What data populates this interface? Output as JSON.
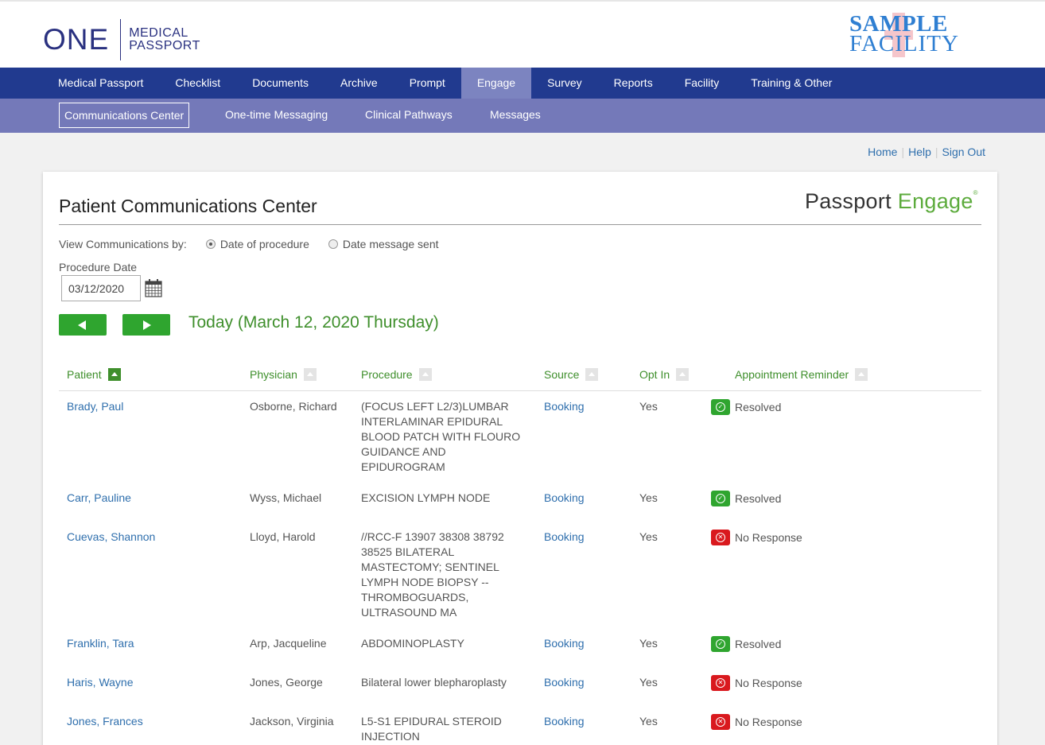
{
  "logo": {
    "one": "ONE",
    "line1": "MEDICAL",
    "line2": "PASSPORT"
  },
  "facility": {
    "line1": "SAMPLE",
    "line2": "FACILITY"
  },
  "main_nav": [
    {
      "label": "Medical Passport"
    },
    {
      "label": "Checklist"
    },
    {
      "label": "Documents"
    },
    {
      "label": "Archive"
    },
    {
      "label": "Prompt"
    },
    {
      "label": "Engage",
      "active": true
    },
    {
      "label": "Survey"
    },
    {
      "label": "Reports"
    },
    {
      "label": "Facility"
    },
    {
      "label": "Training & Other"
    }
  ],
  "sub_nav": [
    {
      "label": "Communications Center",
      "active": true
    },
    {
      "label": "One-time Messaging"
    },
    {
      "label": "Clinical Pathways"
    },
    {
      "label": "Messages"
    }
  ],
  "top_links": {
    "home": "Home",
    "help": "Help",
    "sign_out": "Sign Out"
  },
  "panel": {
    "title": "Patient Communications Center",
    "brand_a": "Passport",
    "brand_b": "Engage",
    "view_by_label": "View Communications by:",
    "options": [
      {
        "label": "Date of procedure",
        "selected": true
      },
      {
        "label": "Date message sent",
        "selected": false
      }
    ],
    "procedure_date_label": "Procedure Date",
    "procedure_date_value": "03/12/2020",
    "today": "Today (March 12, 2020 Thursday)"
  },
  "table": {
    "headers": {
      "patient": "Patient",
      "physician": "Physician",
      "procedure": "Procedure",
      "source": "Source",
      "opt_in": "Opt In",
      "reminder": "Appointment Reminder"
    },
    "rows": [
      {
        "patient": "Brady, Paul",
        "physician": "Osborne, Richard",
        "procedure": "(FOCUS LEFT L2/3)LUMBAR INTERLAMINAR EPIDURAL BLOOD PATCH WITH FLOURO GUIDANCE AND EPIDUROGRAM",
        "source": "Booking",
        "opt_in": "Yes",
        "reminder": "Resolved",
        "status": "ok"
      },
      {
        "patient": "Carr, Pauline",
        "physician": "Wyss, Michael",
        "procedure": "EXCISION LYMPH NODE",
        "source": "Booking",
        "opt_in": "Yes",
        "reminder": "Resolved",
        "status": "ok"
      },
      {
        "patient": "Cuevas, Shannon",
        "physician": "Lloyd, Harold",
        "procedure": "//RCC-F 13907 38308 38792 38525 BILATERAL MASTECTOMY; SENTINEL LYMPH NODE BIOPSY -- THROMBOGUARDS, ULTRASOUND MA",
        "source": "Booking",
        "opt_in": "Yes",
        "reminder": "No Response",
        "status": "no"
      },
      {
        "patient": "Franklin, Tara",
        "physician": "Arp, Jacqueline",
        "procedure": "ABDOMINOPLASTY",
        "source": "Booking",
        "opt_in": "Yes",
        "reminder": "Resolved",
        "status": "ok"
      },
      {
        "patient": "Haris, Wayne",
        "physician": "Jones, George",
        "procedure": "Bilateral lower blepharoplasty",
        "source": "Booking",
        "opt_in": "Yes",
        "reminder": "No Response",
        "status": "no"
      },
      {
        "patient": "Jones, Frances",
        "physician": "Jackson, Virginia",
        "procedure": "L5-S1 EPIDURAL STEROID INJECTION",
        "source": "Booking",
        "opt_in": "Yes",
        "reminder": "No Response",
        "status": "no"
      }
    ]
  }
}
